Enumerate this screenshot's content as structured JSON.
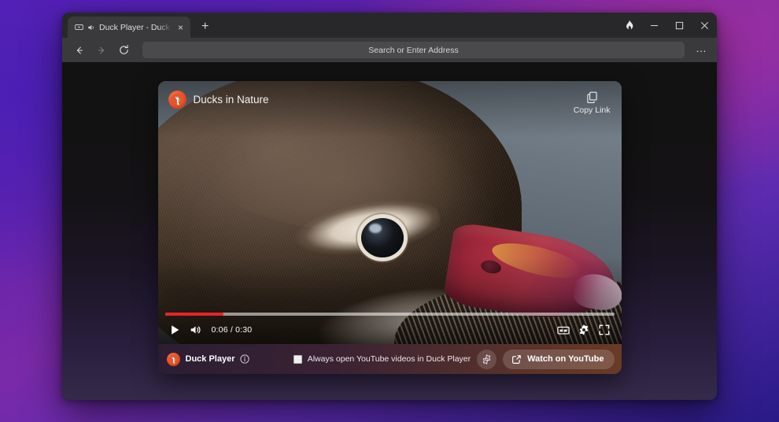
{
  "window": {
    "tab": {
      "title": "Duck Player - Ducks in Nature",
      "video_icon": "video-play-icon",
      "audio_icon": "speaker-audio-playing-icon",
      "close_label": "×"
    },
    "new_tab_label": "+",
    "controls": {
      "fire_label": "fire-button",
      "minimize_label": "–",
      "maximize_label": "□",
      "close_label": "×"
    }
  },
  "toolbar": {
    "back_label": "←",
    "forward_label": "→",
    "reload_label": "reload",
    "address_placeholder": "Search or Enter Address",
    "address_value": "",
    "menu_label": "…"
  },
  "player": {
    "brand_logo": "duckduckgo-logo",
    "video_title": "Ducks in Nature",
    "copy_link_label": "Copy Link",
    "copy_link_icon": "copy-icon",
    "controls": {
      "play_label": "play",
      "volume_label": "volume",
      "time_display": "0:06 / 0:30",
      "current_time": "0:06",
      "duration": "0:30",
      "progress_percent": 13,
      "captions_label": "CC",
      "settings_label": "settings",
      "fullscreen_label": "fullscreen"
    },
    "bottom": {
      "brand_label": "Duck Player",
      "info_label": "i",
      "checkbox_label": "Always open YouTube videos in Duck Player",
      "checkbox_checked": false,
      "settings_label": "settings",
      "watch_label": "Watch on YouTube"
    }
  },
  "colors": {
    "accent_orange": "#e8471f",
    "progress_red": "#e8222b",
    "desktop_purple": "#5a21b8",
    "desktop_magenta": "#9d2fa0"
  }
}
